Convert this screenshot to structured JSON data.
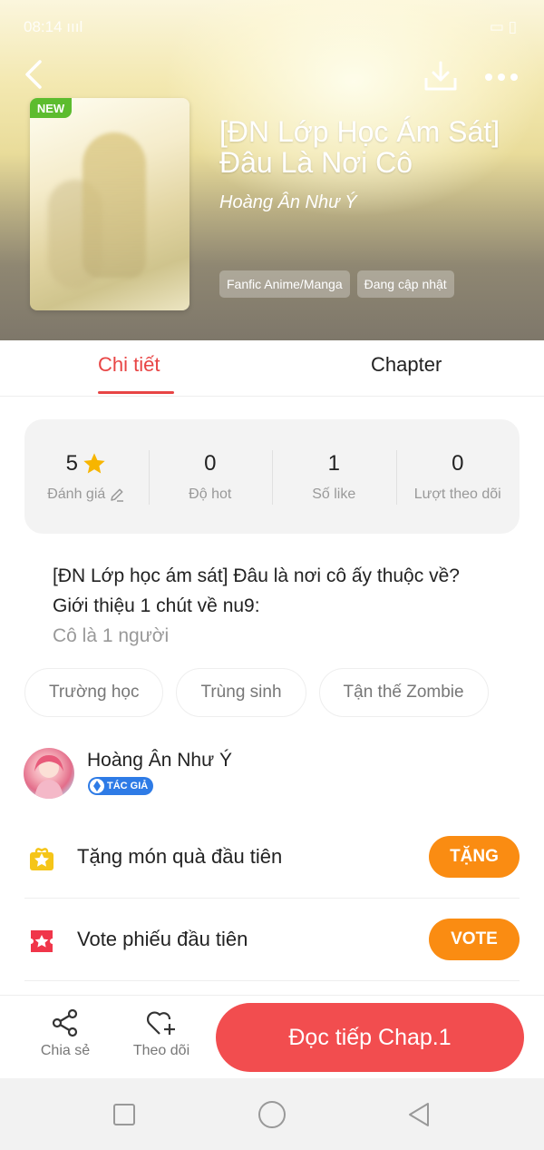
{
  "status_bar": {
    "time": "08:14",
    "signal": "ıııl",
    "battery": "▭ ▯"
  },
  "header": {
    "back_icon": "chevron-left-icon",
    "download_icon": "download-icon",
    "more_icon": "more-dots-icon",
    "badge": "NEW",
    "title": "[ĐN Lớp Học Ám Sát] Đâu Là Nơi Cô",
    "author": "Hoàng Ân Như Ý",
    "tags": [
      "Fanfic Anime/Manga",
      "Đang cập nhật"
    ]
  },
  "tabs": [
    {
      "label": "Chi tiết",
      "active": true
    },
    {
      "label": "Chapter",
      "active": false
    }
  ],
  "stats": [
    {
      "value": "5",
      "label": "Đánh giá",
      "icon": "star-icon",
      "label_icon": "edit-icon"
    },
    {
      "value": "0",
      "label": "Độ hot"
    },
    {
      "value": "1",
      "label": "Số like"
    },
    {
      "value": "0",
      "label": "Lượt theo dõi"
    }
  ],
  "description": {
    "line1": "[ĐN Lớp học ám sát] Đâu là nơi cô ấy thuộc về?",
    "line2": "Giới thiệu 1 chút về nu9:",
    "line3": "Cô là 1 người"
  },
  "genres": [
    "Trường học",
    "Trùng sinh",
    "Tận thế Zombie"
  ],
  "author": {
    "name": "Hoàng Ân Như Ý",
    "badge": "TÁC GIẢ"
  },
  "actions": [
    {
      "label": "Tặng món quà đầu tiên",
      "button": "TẶNG",
      "icon": "gift-icon"
    },
    {
      "label": "Vote phiếu đầu tiên",
      "button": "VOTE",
      "icon": "ticket-icon"
    }
  ],
  "bottom_bar": {
    "share_label": "Chia sẻ",
    "follow_label": "Theo dõi",
    "read_button": "Đọc tiếp Chap.1"
  },
  "colors": {
    "accent": "#e84545",
    "orange": "#fa8c12",
    "read_button": "#f24d4f",
    "new_badge": "#5cbc2e",
    "author_badge": "#2e7be6"
  }
}
